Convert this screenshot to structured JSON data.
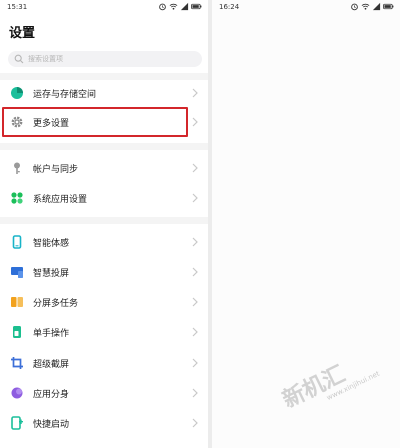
{
  "left_screen": {
    "status_bar": {
      "time": "15:31"
    },
    "title": "设置",
    "search": {
      "placeholder": "搜索设置项"
    },
    "items": [
      {
        "label": "运存与存储空间",
        "icon": "storage-pie-icon",
        "color": "#1bbf9b"
      },
      {
        "label": "更多设置",
        "icon": "gear-icon",
        "color": "#8a8a8a"
      },
      {
        "label": "帐户与同步",
        "icon": "account-key-icon",
        "color": "#9a9a9a"
      },
      {
        "label": "系统应用设置",
        "icon": "apps-grid-icon",
        "color": "#1bbf5a"
      },
      {
        "label": "智能体感",
        "icon": "phone-motion-icon",
        "color": "#18b4c8"
      },
      {
        "label": "智慧投屏",
        "icon": "screen-cast-icon",
        "color": "#2e6fd8"
      },
      {
        "label": "分屏多任务",
        "icon": "split-screen-icon",
        "color": "#f2a21e"
      },
      {
        "label": "单手操作",
        "icon": "one-hand-icon",
        "color": "#1bbf8f"
      },
      {
        "label": "超级截屏",
        "icon": "crop-screenshot-icon",
        "color": "#3c6fd8"
      },
      {
        "label": "应用分身",
        "icon": "app-clone-icon",
        "color": "#8e5de0"
      },
      {
        "label": "快捷启动",
        "icon": "quick-launch-icon",
        "color": "#1bbf9b"
      }
    ]
  },
  "right_screen": {
    "status_bar": {
      "time": "16:24"
    }
  },
  "annotation": {
    "highlighted_item": "更多设置",
    "highlight_color": "#d3262b"
  },
  "watermark": {
    "text": "新机汇",
    "url": "www.xinjihui.net"
  }
}
